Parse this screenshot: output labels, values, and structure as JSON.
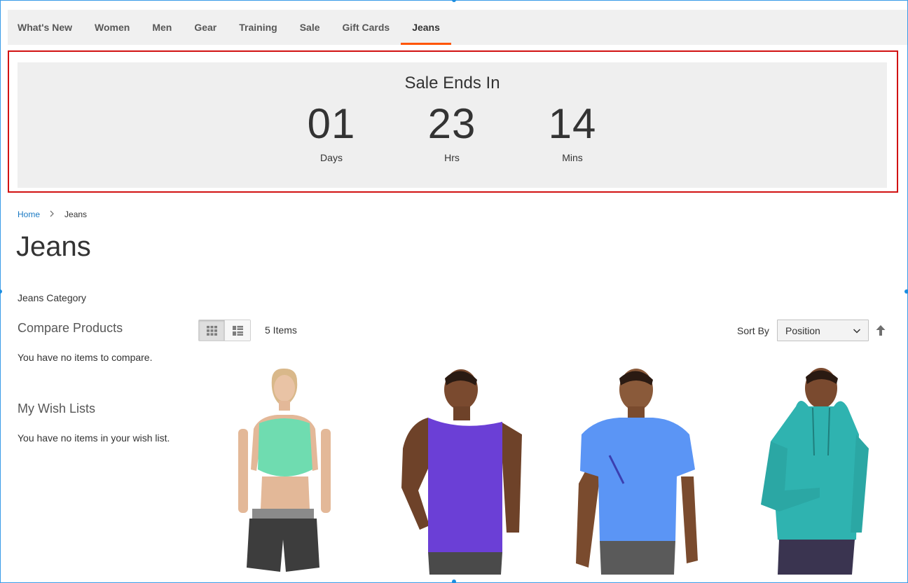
{
  "nav": {
    "items": [
      {
        "label": "What's New"
      },
      {
        "label": "Women"
      },
      {
        "label": "Men"
      },
      {
        "label": "Gear"
      },
      {
        "label": "Training"
      },
      {
        "label": "Sale"
      },
      {
        "label": "Gift Cards"
      },
      {
        "label": "Jeans"
      }
    ],
    "active": "Jeans"
  },
  "countdown": {
    "title": "Sale Ends In",
    "units": [
      {
        "value": "01",
        "label": "Days"
      },
      {
        "value": "23",
        "label": "Hrs"
      },
      {
        "value": "14",
        "label": "Mins"
      }
    ]
  },
  "breadcrumb": {
    "home": "Home",
    "current": "Jeans"
  },
  "page": {
    "title": "Jeans",
    "description": "Jeans Category"
  },
  "sidebar": {
    "compare_title": "Compare Products",
    "compare_text": "You have no items to compare.",
    "wishlist_title": "My Wish Lists",
    "wishlist_text": "You have no items in your wish list."
  },
  "toolbar": {
    "items_count": "5 Items",
    "sort_label": "Sort By",
    "sort_value": "Position",
    "view_modes": [
      "grid-icon",
      "list-icon"
    ],
    "sort_direction_icon": "arrow-up-icon"
  },
  "products": [
    {
      "image": "woman-mint-sports-bra-image",
      "colors": {
        "top": "#6fdcb0",
        "bottom": "#3d3d3d"
      }
    },
    {
      "image": "man-purple-tank-image",
      "colors": {
        "top": "#6b3fd6",
        "bottom": "#4a4a4a"
      }
    },
    {
      "image": "man-blue-tee-image",
      "colors": {
        "top": "#5b95f5",
        "bottom": "#5a5a5a"
      }
    },
    {
      "image": "man-teal-hoodie-image",
      "colors": {
        "top": "#2fb3b0",
        "bottom": "#3a3450"
      }
    }
  ],
  "colors": {
    "accent": "#ff5501",
    "link": "#1979c3",
    "highlight_border": "#d11212"
  }
}
